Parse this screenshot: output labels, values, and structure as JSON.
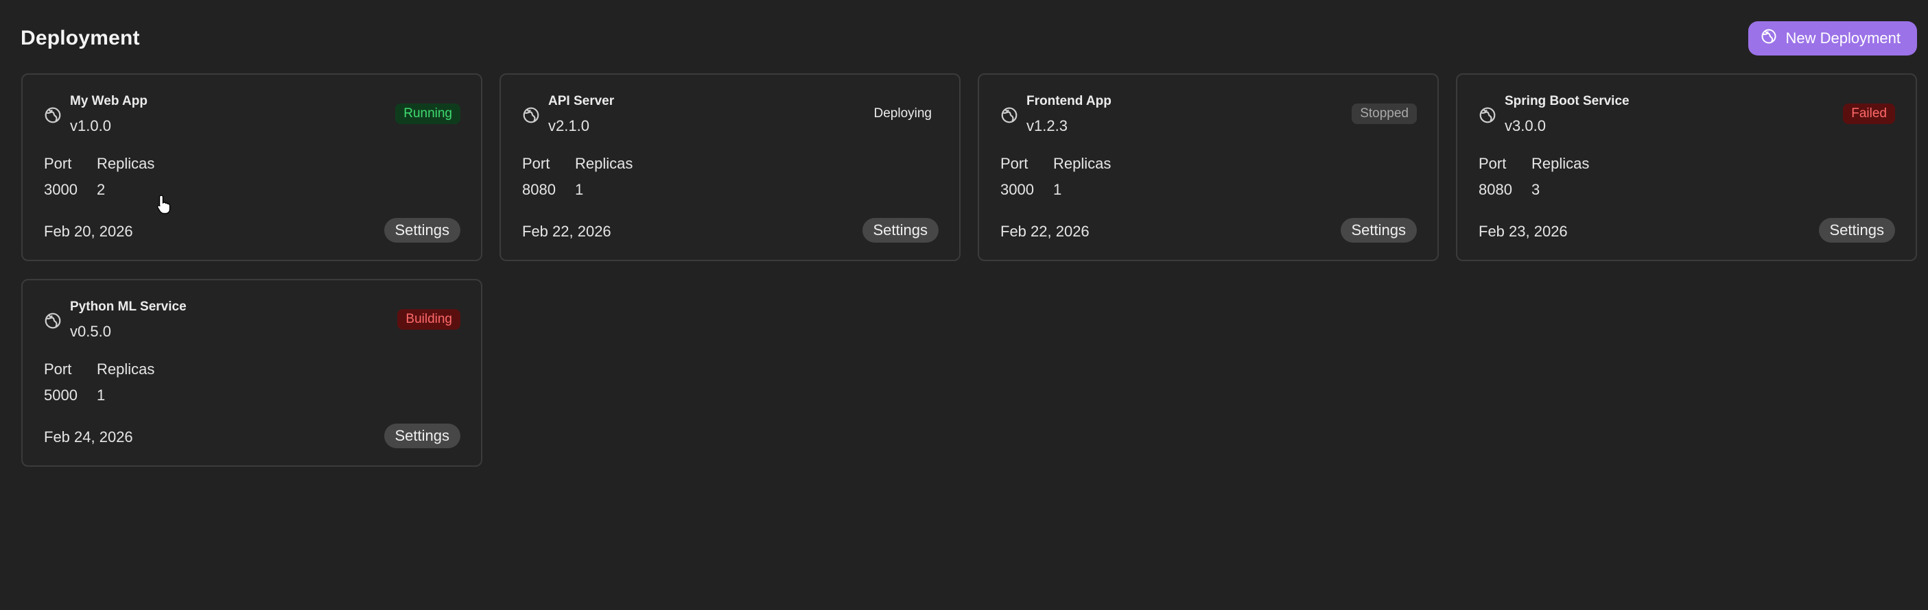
{
  "header": {
    "title": "Deployment",
    "new_button_label": "New Deployment",
    "new_button_icon": "globe-icon"
  },
  "labels": {
    "port": "Port",
    "replicas": "Replicas",
    "settings": "Settings"
  },
  "colors": {
    "accent": "#9b72e8",
    "running": "#3fdb6f",
    "failed": "#ff6a6a",
    "background": "#222222"
  },
  "deployments": [
    {
      "name": "My Web App",
      "version": "v1.0.0",
      "status": "Running",
      "port": "3000",
      "replicas": "2",
      "date": "Feb 20, 2026",
      "icon": "globe-icon"
    },
    {
      "name": "API Server",
      "version": "v2.1.0",
      "status": "Deploying",
      "port": "8080",
      "replicas": "1",
      "date": "Feb 22, 2026",
      "icon": "globe-icon"
    },
    {
      "name": "Frontend App",
      "version": "v1.2.3",
      "status": "Stopped",
      "port": "3000",
      "replicas": "1",
      "date": "Feb 22, 2026",
      "icon": "globe-icon"
    },
    {
      "name": "Spring Boot Service",
      "version": "v3.0.0",
      "status": "Failed",
      "port": "8080",
      "replicas": "3",
      "date": "Feb 23, 2026",
      "icon": "globe-icon"
    },
    {
      "name": "Python ML Service",
      "version": "v0.5.0",
      "status": "Building",
      "port": "5000",
      "replicas": "1",
      "date": "Feb 24, 2026",
      "icon": "globe-icon"
    }
  ]
}
